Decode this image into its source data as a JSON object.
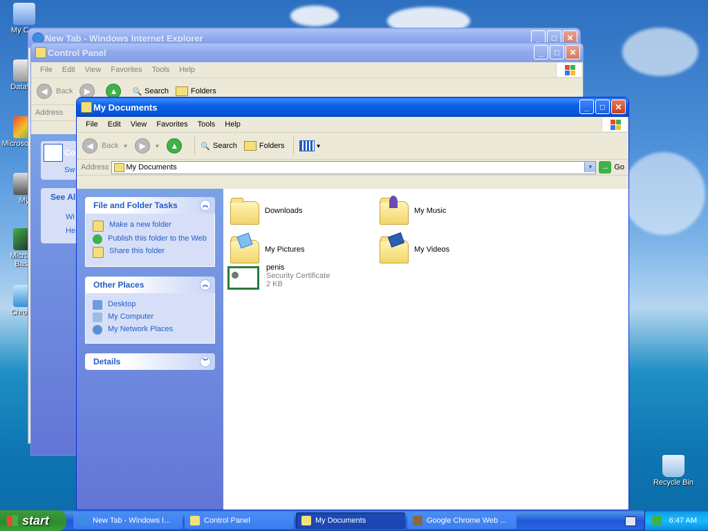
{
  "desktop": {
    "icons_left": [
      {
        "label": "My Con"
      },
      {
        "label": "DataWa"
      },
      {
        "label": "Microsol C++"
      },
      {
        "label": "My"
      },
      {
        "label": "Microsol Basic"
      },
      {
        "label": "Chrome"
      }
    ],
    "recycle_bin": "Recycle Bin"
  },
  "ie_window": {
    "title": "New Tab - Windows Internet Explorer"
  },
  "control_panel": {
    "title": "Control Panel",
    "menu": [
      "File",
      "Edit",
      "View",
      "Favorites",
      "Tools",
      "Help"
    ],
    "toolbar": {
      "back": "Back",
      "search": "Search",
      "folders": "Folders"
    },
    "address_label": "Address",
    "pane_title_partial": "Con",
    "pane_switch_partial": "Sw",
    "see_also_partial": "See Als",
    "see_also_items": [
      "Wi",
      "He"
    ]
  },
  "my_documents": {
    "title": "My Documents",
    "menu": [
      "File",
      "Edit",
      "View",
      "Favorites",
      "Tools",
      "Help"
    ],
    "toolbar": {
      "back": "Back",
      "search": "Search",
      "folders": "Folders"
    },
    "address": {
      "label": "Address",
      "value": "My Documents",
      "go": "Go"
    },
    "tasks": {
      "title": "File and Folder Tasks",
      "items": [
        "Make a new folder",
        "Publish this folder to the Web",
        "Share this folder"
      ]
    },
    "places": {
      "title": "Other Places",
      "items": [
        "Desktop",
        "My Computer",
        "My Network Places"
      ]
    },
    "details": {
      "title": "Details"
    },
    "files": [
      {
        "name": "Downloads"
      },
      {
        "name": "My Music"
      },
      {
        "name": "My Pictures"
      },
      {
        "name": "My Videos"
      },
      {
        "name": "penis",
        "type": "Security Certificate",
        "size": "2 KB"
      }
    ]
  },
  "taskbar": {
    "start": "start",
    "tasks": [
      "New Tab - Windows I...",
      "Control Panel",
      "My Documents",
      "Google Chrome Web ..."
    ],
    "clock": "6:47 AM"
  }
}
